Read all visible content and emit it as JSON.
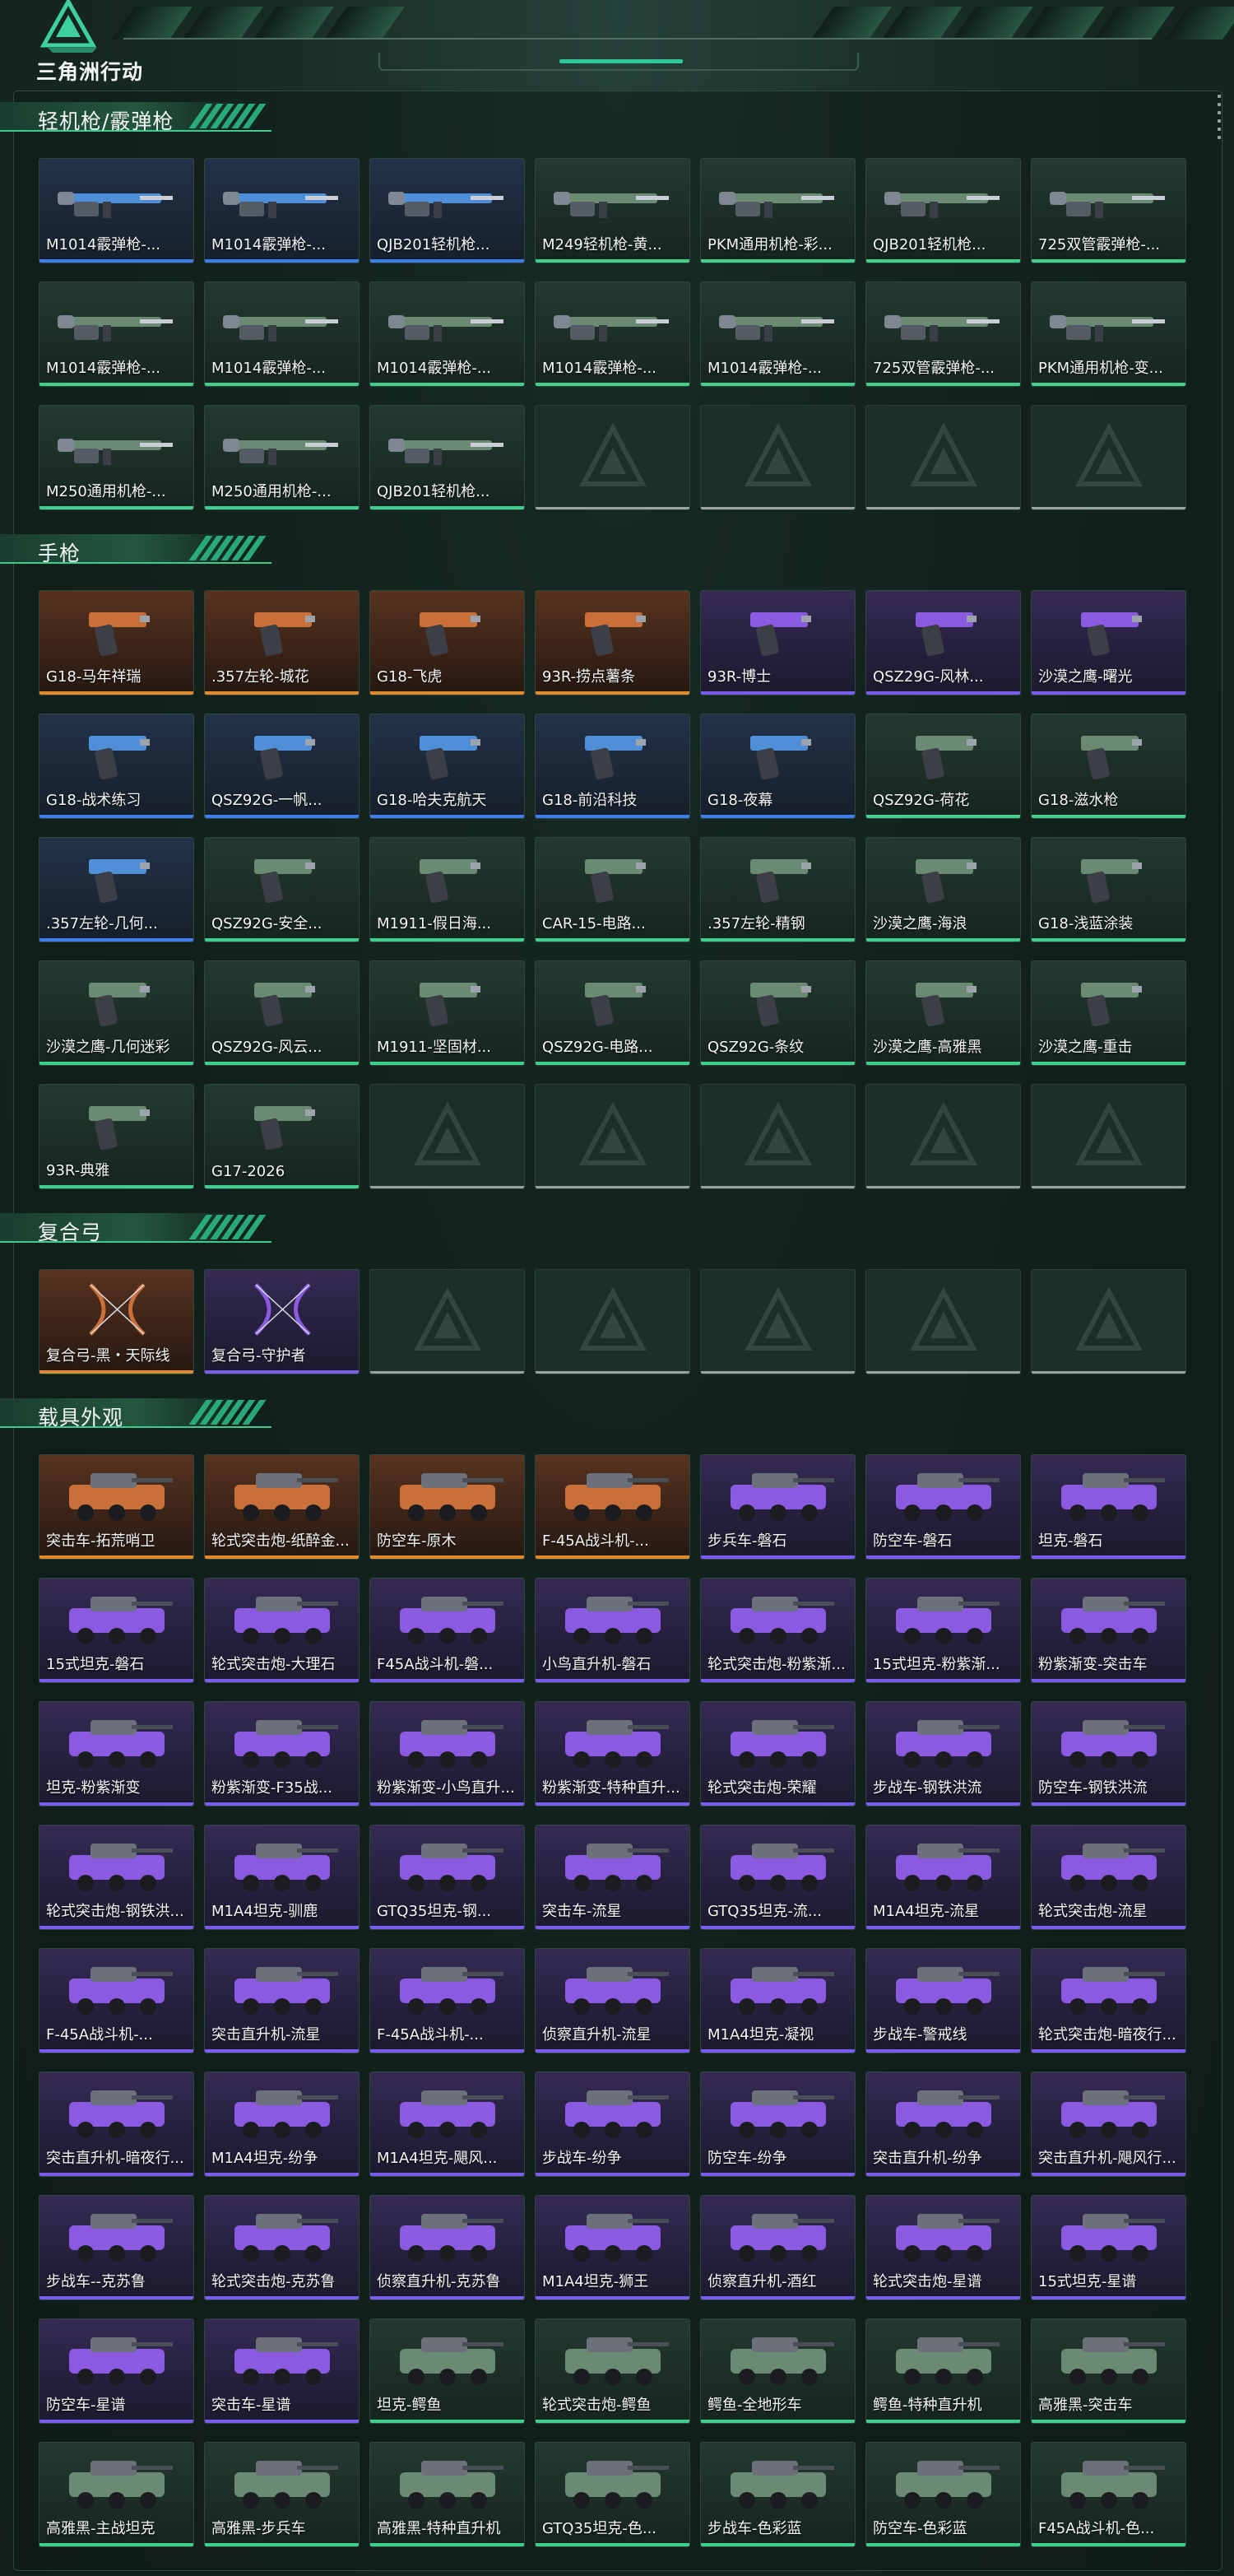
{
  "app": {
    "logo_text": "三角洲行动"
  },
  "colors": {
    "accent": "#3ecb8d",
    "purple": "#7a5cf0",
    "blue": "#3d7df0",
    "gold": "#e08a2c",
    "green": "#3fcf8f"
  },
  "sections": [
    {
      "title": "轻机枪/霰弹枪",
      "kind": "gun",
      "items": [
        {
          "label": "M1014霰弹枪-...",
          "rarity": "blue"
        },
        {
          "label": "M1014霰弹枪-...",
          "rarity": "blue"
        },
        {
          "label": "QJB201轻机枪...",
          "rarity": "blue"
        },
        {
          "label": "M249轻机枪-黄...",
          "rarity": "green"
        },
        {
          "label": "PKM通用机枪-彩...",
          "rarity": "green"
        },
        {
          "label": "QJB201轻机枪...",
          "rarity": "green"
        },
        {
          "label": "725双管霰弹枪-...",
          "rarity": "green"
        },
        {
          "label": "M1014霰弹枪-...",
          "rarity": "green"
        },
        {
          "label": "M1014霰弹枪-...",
          "rarity": "green"
        },
        {
          "label": "M1014霰弹枪-...",
          "rarity": "green"
        },
        {
          "label": "M1014霰弹枪-...",
          "rarity": "green"
        },
        {
          "label": "M1014霰弹枪-...",
          "rarity": "green"
        },
        {
          "label": "725双管霰弹枪-...",
          "rarity": "green"
        },
        {
          "label": "PKM通用机枪-变...",
          "rarity": "green"
        },
        {
          "label": "M250通用机枪-...",
          "rarity": "green"
        },
        {
          "label": "M250通用机枪-...",
          "rarity": "green"
        },
        {
          "label": "QJB201轻机枪...",
          "rarity": "green"
        },
        {
          "label": "",
          "rarity": "empty"
        },
        {
          "label": "",
          "rarity": "empty"
        },
        {
          "label": "",
          "rarity": "empty"
        },
        {
          "label": "",
          "rarity": "empty"
        }
      ]
    },
    {
      "title": "手枪",
      "kind": "pistol",
      "items": [
        {
          "label": "G18-马年祥瑞",
          "rarity": "gold"
        },
        {
          "label": ".357左轮-城花",
          "rarity": "gold"
        },
        {
          "label": "G18-飞虎",
          "rarity": "gold"
        },
        {
          "label": "93R-捞点薯条",
          "rarity": "gold"
        },
        {
          "label": "93R-博士",
          "rarity": "purple"
        },
        {
          "label": "QSZ29G-风林...",
          "rarity": "purple"
        },
        {
          "label": "沙漠之鹰-曙光",
          "rarity": "purple"
        },
        {
          "label": "G18-战术练习",
          "rarity": "blue"
        },
        {
          "label": "QSZ92G-一帆...",
          "rarity": "blue"
        },
        {
          "label": "G18-哈夫克航天",
          "rarity": "blue"
        },
        {
          "label": "G18-前沿科技",
          "rarity": "blue"
        },
        {
          "label": "G18-夜幕",
          "rarity": "blue"
        },
        {
          "label": "QSZ92G-荷花",
          "rarity": "green"
        },
        {
          "label": "G18-滋水枪",
          "rarity": "green"
        },
        {
          "label": ".357左轮-几何...",
          "rarity": "blue"
        },
        {
          "label": "QSZ92G-安全...",
          "rarity": "green"
        },
        {
          "label": "M1911-假日海...",
          "rarity": "green"
        },
        {
          "label": "CAR-15-电路...",
          "rarity": "green"
        },
        {
          "label": ".357左轮-精钢",
          "rarity": "green"
        },
        {
          "label": "沙漠之鹰-海浪",
          "rarity": "green"
        },
        {
          "label": "G18-浅蓝涂装",
          "rarity": "green"
        },
        {
          "label": "沙漠之鹰-几何迷彩",
          "rarity": "green"
        },
        {
          "label": "QSZ92G-风云...",
          "rarity": "green"
        },
        {
          "label": "M1911-坚固材...",
          "rarity": "green"
        },
        {
          "label": "QSZ92G-电路...",
          "rarity": "green"
        },
        {
          "label": "QSZ92G-条纹",
          "rarity": "green"
        },
        {
          "label": "沙漠之鹰-高雅黑",
          "rarity": "green"
        },
        {
          "label": "沙漠之鹰-重击",
          "rarity": "green"
        },
        {
          "label": "93R-典雅",
          "rarity": "green"
        },
        {
          "label": "G17-2026",
          "rarity": "green"
        },
        {
          "label": "",
          "rarity": "empty"
        },
        {
          "label": "",
          "rarity": "empty"
        },
        {
          "label": "",
          "rarity": "empty"
        },
        {
          "label": "",
          "rarity": "empty"
        },
        {
          "label": "",
          "rarity": "empty"
        }
      ]
    },
    {
      "title": "复合弓",
      "kind": "bow",
      "items": [
        {
          "label": "复合弓-黑・天际线",
          "rarity": "gold"
        },
        {
          "label": "复合弓-守护者",
          "rarity": "purple"
        },
        {
          "label": "",
          "rarity": "empty"
        },
        {
          "label": "",
          "rarity": "empty"
        },
        {
          "label": "",
          "rarity": "empty"
        },
        {
          "label": "",
          "rarity": "empty"
        },
        {
          "label": "",
          "rarity": "empty"
        }
      ]
    },
    {
      "title": "载具外观",
      "kind": "vehicle",
      "items": [
        {
          "label": "突击车-拓荒哨卫",
          "rarity": "gold"
        },
        {
          "label": "轮式突击炮-纸醉金...",
          "rarity": "gold"
        },
        {
          "label": "防空车-原木",
          "rarity": "gold"
        },
        {
          "label": "F-45A战斗机-...",
          "rarity": "gold"
        },
        {
          "label": "步兵车-磐石",
          "rarity": "purple"
        },
        {
          "label": "防空车-磐石",
          "rarity": "purple"
        },
        {
          "label": "坦克-磐石",
          "rarity": "purple"
        },
        {
          "label": "15式坦克-磐石",
          "rarity": "purple"
        },
        {
          "label": "轮式突击炮-大理石",
          "rarity": "purple"
        },
        {
          "label": "F45A战斗机-磐...",
          "rarity": "purple"
        },
        {
          "label": "小鸟直升机-磐石",
          "rarity": "purple"
        },
        {
          "label": "轮式突击炮-粉紫渐...",
          "rarity": "purple"
        },
        {
          "label": "15式坦克-粉紫渐...",
          "rarity": "purple"
        },
        {
          "label": "粉紫渐变-突击车",
          "rarity": "purple"
        },
        {
          "label": "坦克-粉紫渐变",
          "rarity": "purple"
        },
        {
          "label": "粉紫渐变-F35战...",
          "rarity": "purple"
        },
        {
          "label": "粉紫渐变-小鸟直升...",
          "rarity": "purple"
        },
        {
          "label": "粉紫渐变-特种直升...",
          "rarity": "purple"
        },
        {
          "label": "轮式突击炮-荣耀",
          "rarity": "purple"
        },
        {
          "label": "步战车-钢铁洪流",
          "rarity": "purple"
        },
        {
          "label": "防空车-钢铁洪流",
          "rarity": "purple"
        },
        {
          "label": "轮式突击炮-钢铁洪...",
          "rarity": "purple"
        },
        {
          "label": "M1A4坦克-驯鹿",
          "rarity": "purple"
        },
        {
          "label": "GTQ35坦克-钢...",
          "rarity": "purple"
        },
        {
          "label": "突击车-流星",
          "rarity": "purple"
        },
        {
          "label": "GTQ35坦克-流...",
          "rarity": "purple"
        },
        {
          "label": "M1A4坦克-流星",
          "rarity": "purple"
        },
        {
          "label": "轮式突击炮-流星",
          "rarity": "purple"
        },
        {
          "label": "F-45A战斗机-...",
          "rarity": "purple"
        },
        {
          "label": "突击直升机-流星",
          "rarity": "purple"
        },
        {
          "label": "F-45A战斗机-...",
          "rarity": "purple"
        },
        {
          "label": "侦察直升机-流星",
          "rarity": "purple"
        },
        {
          "label": "M1A4坦克-凝视",
          "rarity": "purple"
        },
        {
          "label": "步战车-警戒线",
          "rarity": "purple"
        },
        {
          "label": "轮式突击炮-暗夜行...",
          "rarity": "purple"
        },
        {
          "label": "突击直升机-暗夜行...",
          "rarity": "purple"
        },
        {
          "label": "M1A4坦克-纷争",
          "rarity": "purple"
        },
        {
          "label": "M1A4坦克-飓风...",
          "rarity": "purple"
        },
        {
          "label": "步战车-纷争",
          "rarity": "purple"
        },
        {
          "label": "防空车-纷争",
          "rarity": "purple"
        },
        {
          "label": "突击直升机-纷争",
          "rarity": "purple"
        },
        {
          "label": "突击直升机-飓风行...",
          "rarity": "purple"
        },
        {
          "label": "步战车--克苏鲁",
          "rarity": "purple"
        },
        {
          "label": "轮式突击炮-克苏鲁",
          "rarity": "purple"
        },
        {
          "label": "侦察直升机-克苏鲁",
          "rarity": "purple"
        },
        {
          "label": "M1A4坦克-狮王",
          "rarity": "purple"
        },
        {
          "label": "侦察直升机-酒红",
          "rarity": "purple"
        },
        {
          "label": "轮式突击炮-星谱",
          "rarity": "purple"
        },
        {
          "label": "15式坦克-星谱",
          "rarity": "purple"
        },
        {
          "label": "防空车-星谱",
          "rarity": "purple"
        },
        {
          "label": "突击车-星谱",
          "rarity": "purple"
        },
        {
          "label": "坦克-鳄鱼",
          "rarity": "green"
        },
        {
          "label": "轮式突击炮-鳄鱼",
          "rarity": "green"
        },
        {
          "label": "鳄鱼-全地形车",
          "rarity": "green"
        },
        {
          "label": "鳄鱼-特种直升机",
          "rarity": "green"
        },
        {
          "label": "高雅黑-突击车",
          "rarity": "green"
        },
        {
          "label": "高雅黑-主战坦克",
          "rarity": "green"
        },
        {
          "label": "高雅黑-步兵车",
          "rarity": "green"
        },
        {
          "label": "高雅黑-特种直升机",
          "rarity": "green"
        },
        {
          "label": "GTQ35坦克-色...",
          "rarity": "green"
        },
        {
          "label": "步战车-色彩蓝",
          "rarity": "green"
        },
        {
          "label": "防空车-色彩蓝",
          "rarity": "green"
        },
        {
          "label": "F45A战斗机-色...",
          "rarity": "green"
        }
      ]
    }
  ]
}
